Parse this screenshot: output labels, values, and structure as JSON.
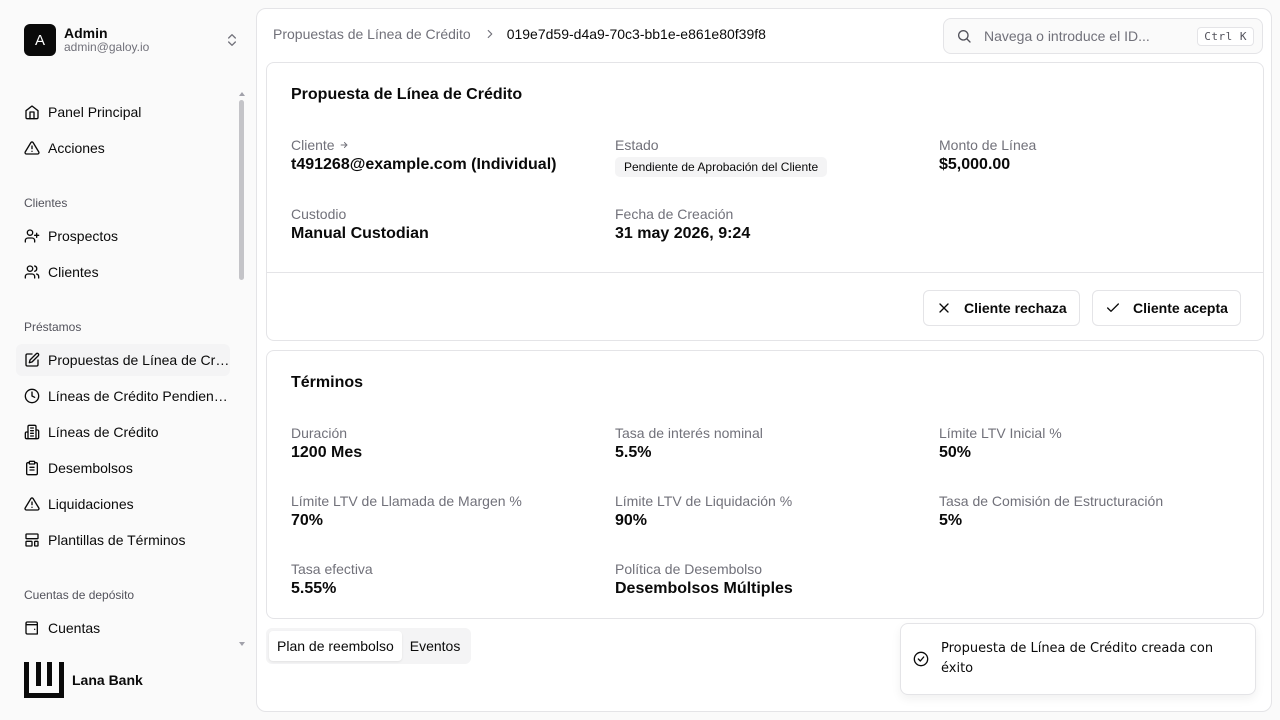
{
  "user": {
    "initial": "A",
    "name": "Admin",
    "email": "admin@galoy.io",
    "menu_icon": "chevrons-up-down-icon"
  },
  "nav": {
    "top_items": [
      {
        "label": "Panel Principal",
        "icon": "home-icon"
      },
      {
        "label": "Acciones",
        "icon": "alert-triangle-icon"
      }
    ],
    "groups": [
      {
        "label": "Clientes",
        "items": [
          {
            "label": "Prospectos",
            "icon": "user-plus-icon"
          },
          {
            "label": "Clientes",
            "icon": "users-icon"
          }
        ]
      },
      {
        "label": "Préstamos",
        "items": [
          {
            "label": "Propuestas de Línea de Crédito",
            "icon": "file-edit-icon",
            "active": true
          },
          {
            "label": "Líneas de Crédito Pendientes",
            "icon": "clock-icon"
          },
          {
            "label": "Líneas de Crédito",
            "icon": "building-icon"
          },
          {
            "label": "Desembolsos",
            "icon": "clipboard-icon"
          },
          {
            "label": "Liquidaciones",
            "icon": "alert-triangle-icon"
          },
          {
            "label": "Plantillas de Términos",
            "icon": "layout-template-icon"
          }
        ]
      },
      {
        "label": "Cuentas de depósito",
        "items": [
          {
            "label": "Cuentas",
            "icon": "wallet-icon"
          }
        ]
      }
    ]
  },
  "brand": {
    "name": "Lana Bank",
    "icon": "lana-logo-icon"
  },
  "breadcrumb": {
    "parent": "Propuestas de Línea de Crédito",
    "current": "019e7d59-d4a9-70c3-bb1e-e861e80f39f8"
  },
  "search": {
    "placeholder": "Navega o introduce el ID...",
    "shortcut": "Ctrl K"
  },
  "proposal": {
    "title": "Propuesta de Línea de Crédito",
    "client_label": "Cliente",
    "client_value": "t491268@example.com (Individual)",
    "status_label": "Estado",
    "status_value": "Pendiente de Aprobación del Cliente",
    "amount_label": "Monto de Línea",
    "amount_value": "$5,000.00",
    "custodian_label": "Custodio",
    "custodian_value": "Manual Custodian",
    "created_label": "Fecha de Creación",
    "created_value": "31 may 2026, 9:24",
    "reject_button": "Cliente rechaza",
    "accept_button": "Cliente acepta"
  },
  "terms": {
    "title": "Términos",
    "fields": [
      {
        "label": "Duración",
        "value": "1200 Mes"
      },
      {
        "label": "Tasa de interés nominal",
        "value": "5.5%"
      },
      {
        "label": "Límite LTV Inicial %",
        "value": "50%"
      },
      {
        "label": "Límite LTV de Llamada de Margen %",
        "value": "70%"
      },
      {
        "label": "Límite LTV de Liquidación %",
        "value": "90%"
      },
      {
        "label": "Tasa de Comisión de Estructuración",
        "value": "5%"
      },
      {
        "label": "Tasa efectiva",
        "value": "5.55%"
      },
      {
        "label": "Política de Desembolso",
        "value": "Desembolsos Múltiples"
      }
    ]
  },
  "tabs": [
    {
      "label": "Plan de reembolso",
      "active": true
    },
    {
      "label": "Eventos",
      "active": false
    }
  ],
  "toast": {
    "message": "Propuesta de Línea de Crédito creada con éxito",
    "icon": "check-circle-icon"
  }
}
